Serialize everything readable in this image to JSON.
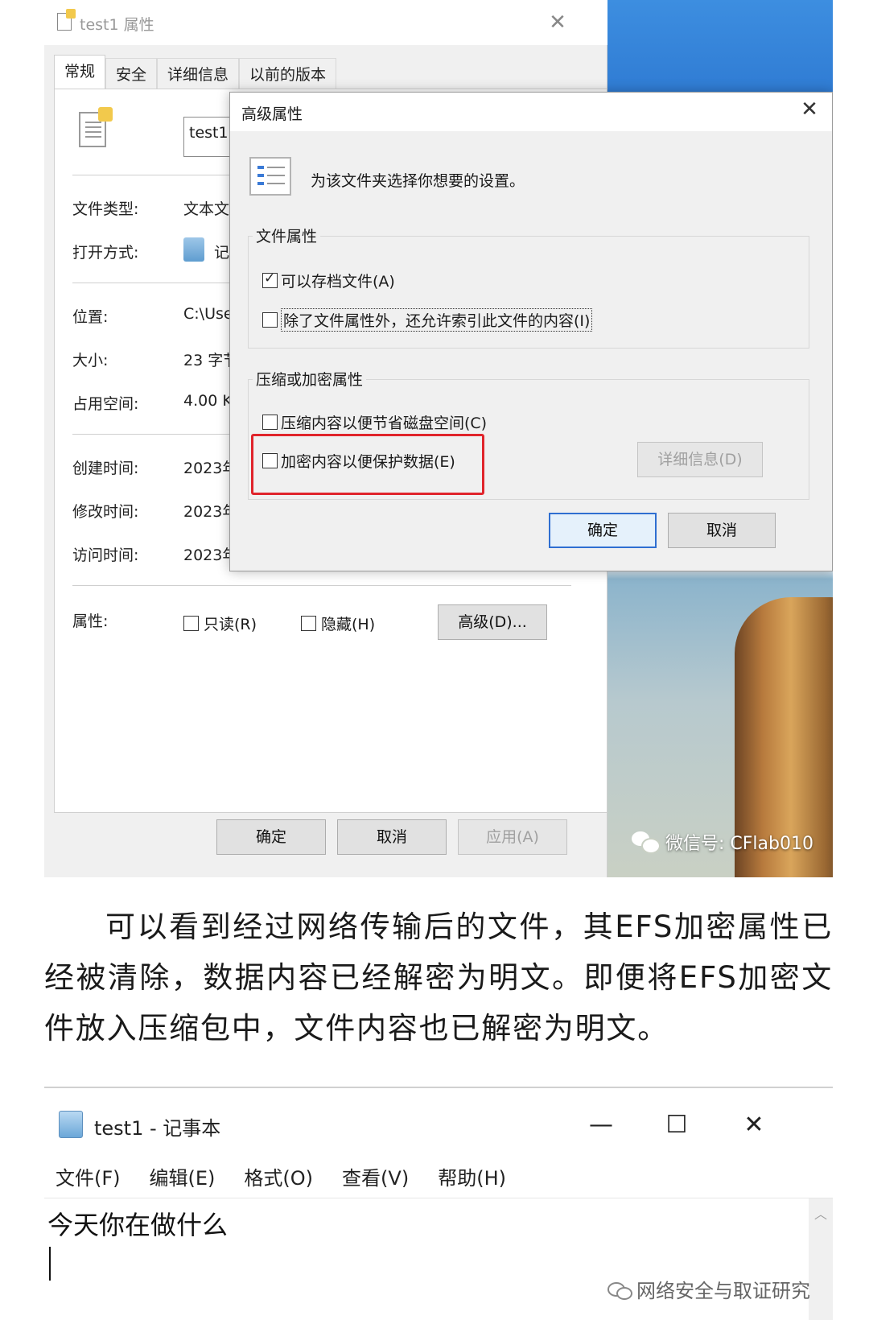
{
  "properties_window": {
    "title": "test1 属性",
    "close_glyph": "✕",
    "tabs": [
      {
        "label": "常规"
      },
      {
        "label": "安全"
      },
      {
        "label": "详细信息"
      },
      {
        "label": "以前的版本"
      }
    ],
    "filename": "test1",
    "fields": {
      "file_type_label": "文件类型:",
      "file_type_value": "文本文",
      "open_with_label": "打开方式:",
      "open_with_value": "记",
      "location_label": "位置:",
      "location_value": "C:\\Use",
      "size_label": "大小:",
      "size_value": "23 字节",
      "disk_size_label": "占用空间:",
      "disk_size_value": "4.00 K",
      "created_label": "创建时间:",
      "created_value": "2023年",
      "modified_label": "修改时间:",
      "modified_value": "2023年",
      "accessed_label": "访问时间:",
      "accessed_value": "2023年"
    },
    "attributes": {
      "label": "属性:",
      "readonly_label": "只读(R)",
      "readonly_checked": false,
      "hidden_label": "隐藏(H)",
      "hidden_checked": false,
      "advanced_button": "高级(D)..."
    },
    "buttons": {
      "ok": "确定",
      "cancel": "取消",
      "apply": "应用(A)"
    }
  },
  "desktop": {
    "watermark": "微信号: CFlab010"
  },
  "advanced_dialog": {
    "title": "高级属性",
    "close_glyph": "✕",
    "description": "为该文件夹选择你想要的设置。",
    "file_attributes_group": {
      "title": "文件属性",
      "archive_label": "可以存档文件(A)",
      "archive_checked": true,
      "index_label": "除了文件属性外，还允许索引此文件的内容(I)",
      "index_checked": false
    },
    "compress_encrypt_group": {
      "title": "压缩或加密属性",
      "compress_label": "压缩内容以便节省磁盘空间(C)",
      "compress_checked": false,
      "encrypt_label": "加密内容以便保护数据(E)",
      "encrypt_checked": false,
      "details_button": "详细信息(D)"
    },
    "buttons": {
      "ok": "确定",
      "cancel": "取消"
    },
    "highlight_color": "#e0242b"
  },
  "paragraph": "可以看到经过网络传输后的文件，其EFS加密属性已经被清除，数据内容已经解密为明文。即便将EFS加密文件放入压缩包中，文件内容也已解密为明文。",
  "notepad": {
    "title": "test1 - 记事本",
    "controls": {
      "minimize": "—",
      "maximize": "☐",
      "close": "✕"
    },
    "menu": [
      "文件(F)",
      "编辑(E)",
      "格式(O)",
      "查看(V)",
      "帮助(H)"
    ],
    "content": "今天你在做什么",
    "scroll_up_glyph": "︿"
  },
  "footer_watermark": "网络安全与取证研究"
}
